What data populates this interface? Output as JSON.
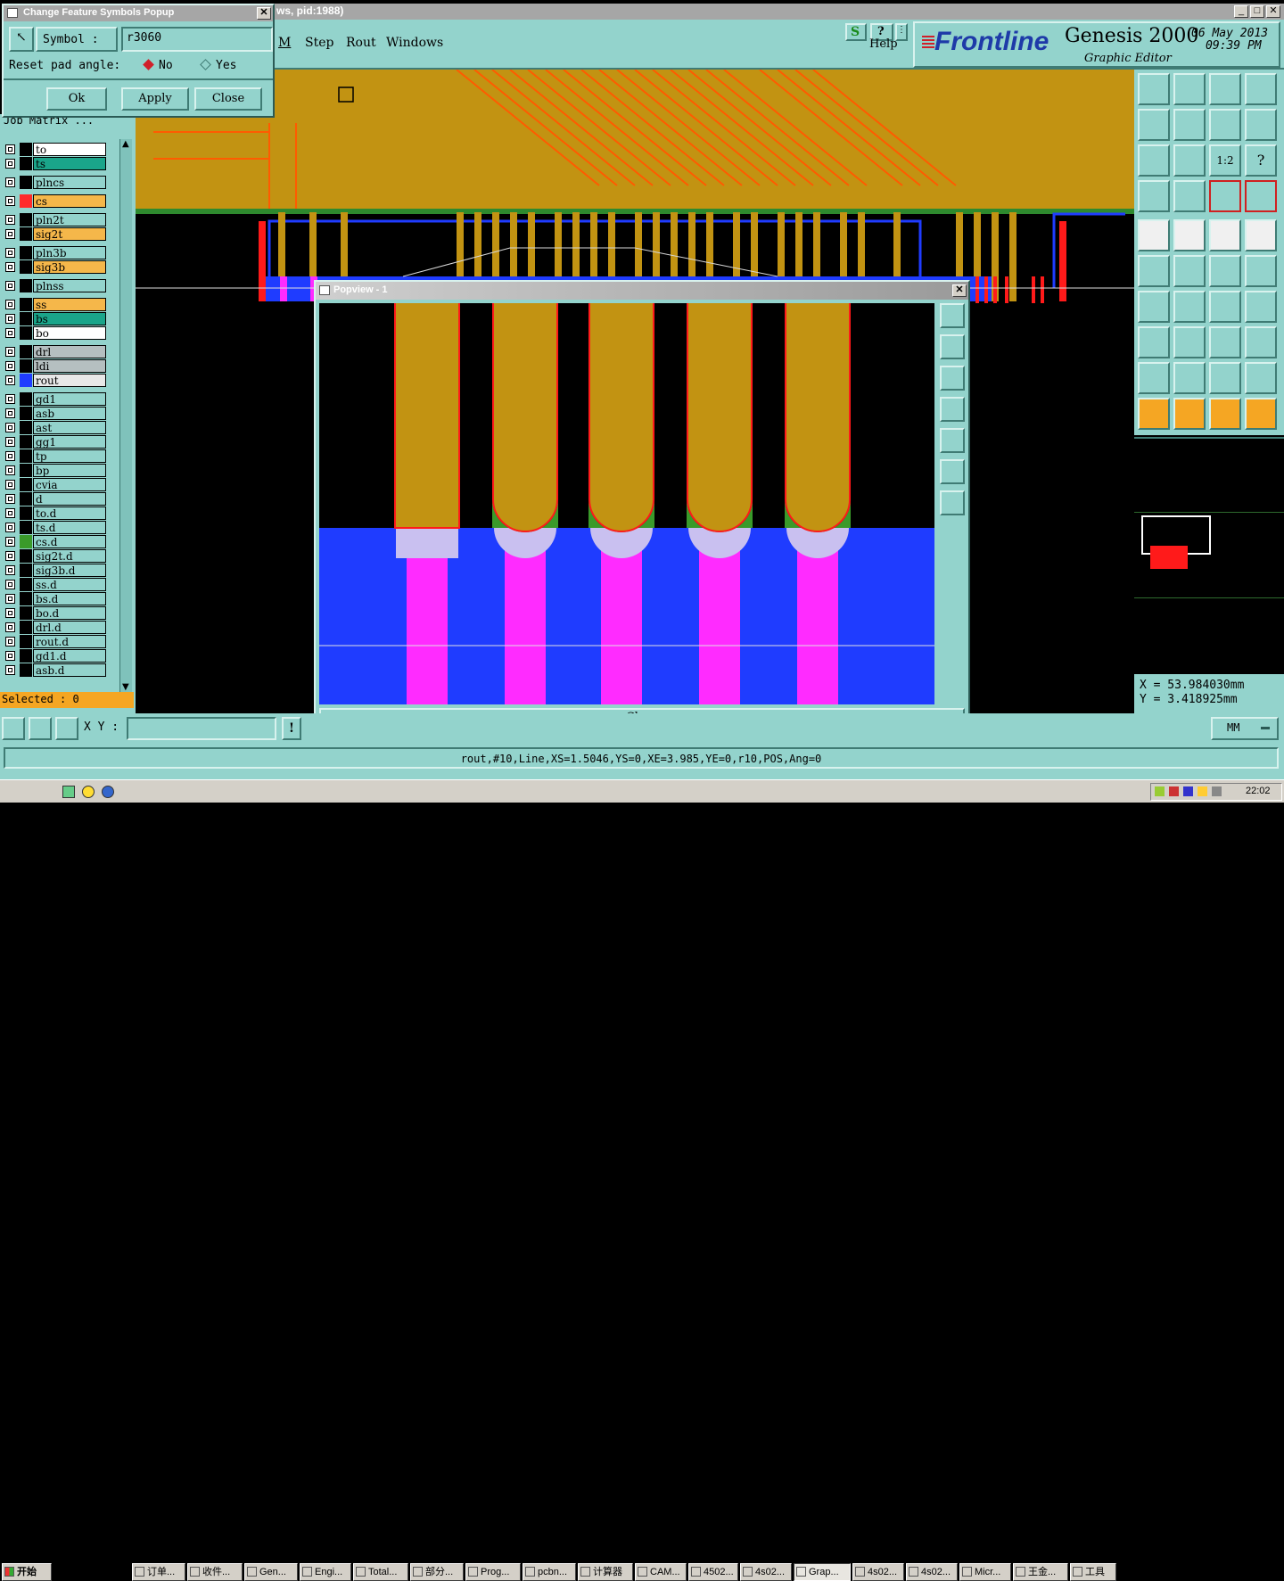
{
  "main_window": {
    "title_fragment": "ws, pid:1988)",
    "menu": [
      "M",
      "Step",
      "Rout",
      "Windows"
    ],
    "help_label": "Help",
    "brand": "Frontline",
    "product": "Genesis 2000",
    "subtitle": "Graphic Editor",
    "date": "06 May 2013",
    "time": "09:39 PM"
  },
  "symbol_popup": {
    "title": "Change Feature Symbols Popup",
    "symbol_label": "Symbol :",
    "symbol_value": "r3060",
    "reset_label": "Reset pad angle:",
    "option_no": "No",
    "option_yes": "Yes",
    "ok": "Ok",
    "apply": "Apply",
    "close": "Close"
  },
  "layer_panel": {
    "header": "Job Matrix ...",
    "selected": "Selected : 0",
    "layers": [
      {
        "name": "to",
        "swatch": "#000000",
        "bg": "#ffffff"
      },
      {
        "name": "ts",
        "swatch": "#000000",
        "bg": "#1aa58a"
      },
      {
        "name": "plncs",
        "swatch": "#000000",
        "bg": "#93d3cc"
      },
      {
        "name": "cs",
        "swatch": "#ff2a2a",
        "bg": "#f5b74a"
      },
      {
        "name": "pln2t",
        "swatch": "#000000",
        "bg": "#93d3cc"
      },
      {
        "name": "sig2t",
        "swatch": "#000000",
        "bg": "#f5b74a"
      },
      {
        "name": "pln3b",
        "swatch": "#000000",
        "bg": "#93d3cc"
      },
      {
        "name": "sig3b",
        "swatch": "#000000",
        "bg": "#f5b74a"
      },
      {
        "name": "plnss",
        "swatch": "#000000",
        "bg": "#93d3cc"
      },
      {
        "name": "ss",
        "swatch": "#000000",
        "bg": "#f5b74a"
      },
      {
        "name": "bs",
        "swatch": "#000000",
        "bg": "#1aa58a"
      },
      {
        "name": "bo",
        "swatch": "#000000",
        "bg": "#ffffff"
      },
      {
        "name": "drl",
        "swatch": "#000000",
        "bg": "#b5bfc0"
      },
      {
        "name": "ldi",
        "swatch": "#000000",
        "bg": "#b5bfc0"
      },
      {
        "name": "rout",
        "swatch": "#1f3cff",
        "bg": "#e8e8e8"
      },
      {
        "name": "gd1",
        "swatch": "#000000",
        "bg": "#93d3cc"
      },
      {
        "name": "asb",
        "swatch": "#000000",
        "bg": "#93d3cc"
      },
      {
        "name": "ast",
        "swatch": "#000000",
        "bg": "#93d3cc"
      },
      {
        "name": "gg1",
        "swatch": "#000000",
        "bg": "#93d3cc"
      },
      {
        "name": "tp",
        "swatch": "#000000",
        "bg": "#93d3cc"
      },
      {
        "name": "bp",
        "swatch": "#000000",
        "bg": "#93d3cc"
      },
      {
        "name": "cvia",
        "swatch": "#000000",
        "bg": "#93d3cc"
      },
      {
        "name": "d",
        "swatch": "#000000",
        "bg": "#93d3cc"
      },
      {
        "name": "to.d",
        "swatch": "#000000",
        "bg": "#93d3cc"
      },
      {
        "name": "ts.d",
        "swatch": "#000000",
        "bg": "#93d3cc"
      },
      {
        "name": "cs.d",
        "swatch": "#3a9a2a",
        "bg": "#93d3cc"
      },
      {
        "name": "sig2t.d",
        "swatch": "#000000",
        "bg": "#93d3cc"
      },
      {
        "name": "sig3b.d",
        "swatch": "#000000",
        "bg": "#93d3cc"
      },
      {
        "name": "ss.d",
        "swatch": "#000000",
        "bg": "#93d3cc"
      },
      {
        "name": "bs.d",
        "swatch": "#000000",
        "bg": "#93d3cc"
      },
      {
        "name": "bo.d",
        "swatch": "#000000",
        "bg": "#93d3cc"
      },
      {
        "name": "drl.d",
        "swatch": "#000000",
        "bg": "#93d3cc"
      },
      {
        "name": "rout.d",
        "swatch": "#000000",
        "bg": "#93d3cc"
      },
      {
        "name": "gd1.d",
        "swatch": "#000000",
        "bg": "#93d3cc"
      },
      {
        "name": "asb.d",
        "swatch": "#000000",
        "bg": "#93d3cc"
      }
    ]
  },
  "popview": {
    "title": "Popview - 1",
    "close": "Close"
  },
  "coords": {
    "x": "X = 53.984030mm",
    "y": "Y = 3.418925mm",
    "units": "MM"
  },
  "xy_label": "X Y :",
  "status_line": "rout,#10,Line,XS=1.5046,YS=0,XE=3.985,YE=0,r10,POS,Ang=0",
  "taskbar": {
    "start": "开始",
    "items": [
      "订单...",
      "收件...",
      "Gen...",
      "Engi...",
      "Total...",
      "部分...",
      "Prog...",
      "pcbn...",
      "计算器",
      "CAM...",
      "4502...",
      "4s02...",
      "Grap...",
      "4s02...",
      "4s02...",
      "Micr...",
      "王金...",
      "工具"
    ],
    "clock": "22:02"
  },
  "colors": {
    "copper": "#c29312",
    "trace": "#ff5b00",
    "rout": "#1f3cff",
    "pad": "#ff2bff",
    "teal": "#93d3cc",
    "orange": "#f5a623"
  }
}
